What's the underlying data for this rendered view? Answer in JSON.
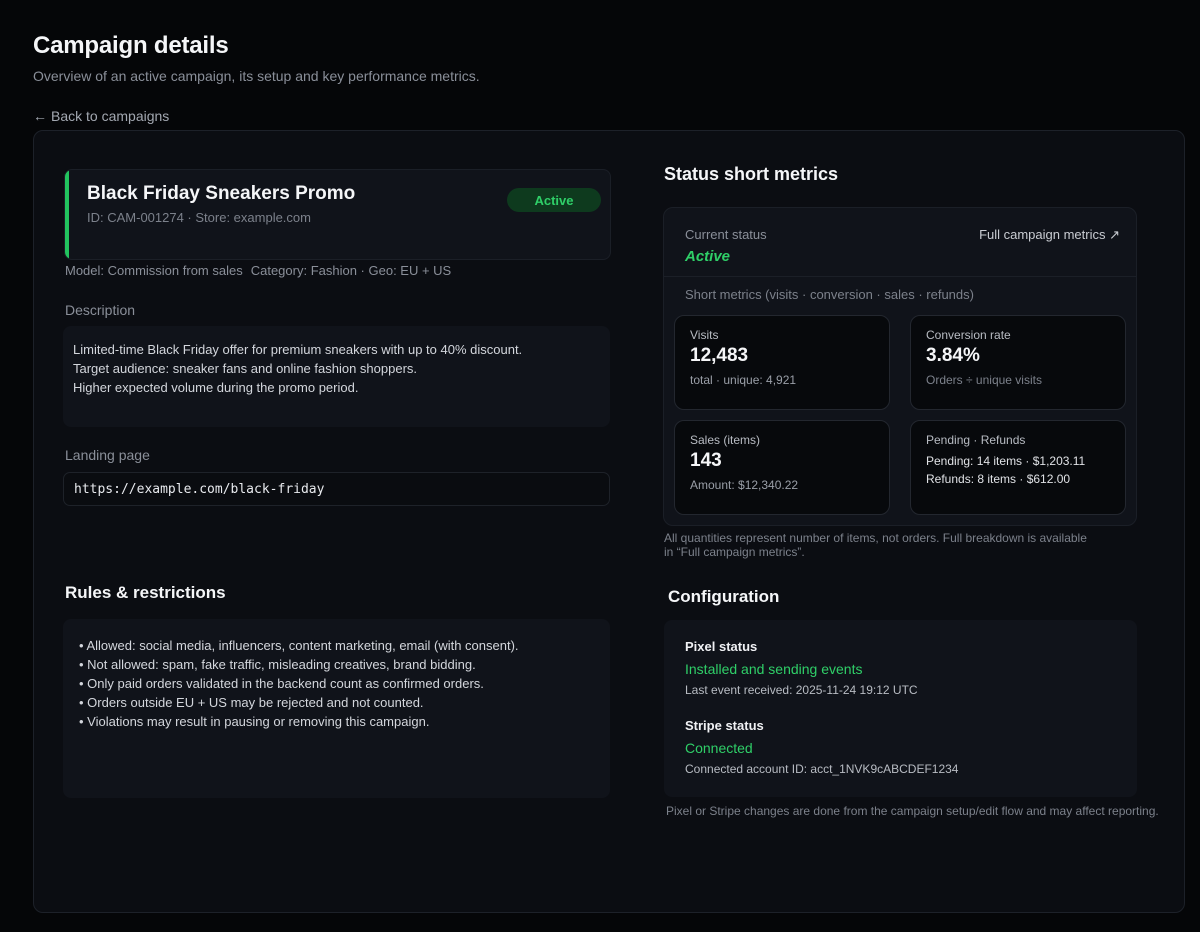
{
  "header": {
    "title": "Campaign details",
    "subtitle": "Overview of an active campaign, its setup and key performance metrics.",
    "back_label": "Back to campaigns"
  },
  "campaign": {
    "name": "Black Friday Sneakers Promo",
    "id_line": "ID: CAM-001274 · Store: example.com",
    "status": "Active",
    "model": "Model: Commission from sales",
    "category_geo": "Category: Fashion · Geo: EU + US"
  },
  "description": {
    "label": "Description",
    "lines": [
      "Limited-time Black Friday offer for premium sneakers with up to 40% discount.",
      "Target audience: sneaker fans and online fashion shoppers.",
      "Higher expected volume during the promo period."
    ]
  },
  "landing": {
    "label": "Landing page",
    "url": "https://example.com/black-friday"
  },
  "rules": {
    "title": "Rules & restrictions",
    "items": [
      "• Allowed: social media, influencers, content marketing, email (with consent).",
      "• Not allowed: spam, fake traffic, misleading creatives, brand bidding.",
      "• Only paid orders validated in the backend count as confirmed orders.",
      "• Orders outside EU + US may be rejected and not counted.",
      "• Violations may result in pausing or removing this campaign."
    ]
  },
  "status_metrics": {
    "title": "Status short metrics",
    "current_status_label": "Current status",
    "current_status": "Active",
    "full_metrics_link": "Full campaign metrics ↗",
    "short_metrics_label": "Short metrics (visits · conversion · sales · refunds)",
    "visits": {
      "label": "Visits",
      "value": "12,483",
      "sub": "total · unique: 4,921"
    },
    "conversion": {
      "label": "Conversion rate",
      "value": "3.84%",
      "sub": "Orders ÷ unique visits"
    },
    "sales": {
      "label": "Sales (items)",
      "value": "143",
      "sub": "Amount: $12,340.22"
    },
    "pending_refunds": {
      "label": "Pending · Refunds",
      "pending": "Pending: 14 items · $1,203.11",
      "refunds": "Refunds: 8 items · $612.00"
    },
    "note_line1": "All quantities represent number of items, not orders.  Full breakdown is available",
    "note_line2": "in  “Full campaign metrics”."
  },
  "configuration": {
    "title": "Configuration",
    "pixel_label": "Pixel status",
    "pixel_value": "Installed and sending events",
    "pixel_detail": "Last event received: 2025-11-24 19:12 UTC",
    "stripe_label": "Stripe status",
    "stripe_value": "Connected",
    "stripe_detail": "Connected account ID: acct_1NVK9cABCDEF1234",
    "note": "Pixel or Stripe changes are done from the campaign setup/edit flow and may affect reporting."
  },
  "colors": {
    "accent_green": "#22c35e",
    "status_green": "#2fcf68",
    "background": "#050608",
    "panel": "#0b0d12"
  }
}
